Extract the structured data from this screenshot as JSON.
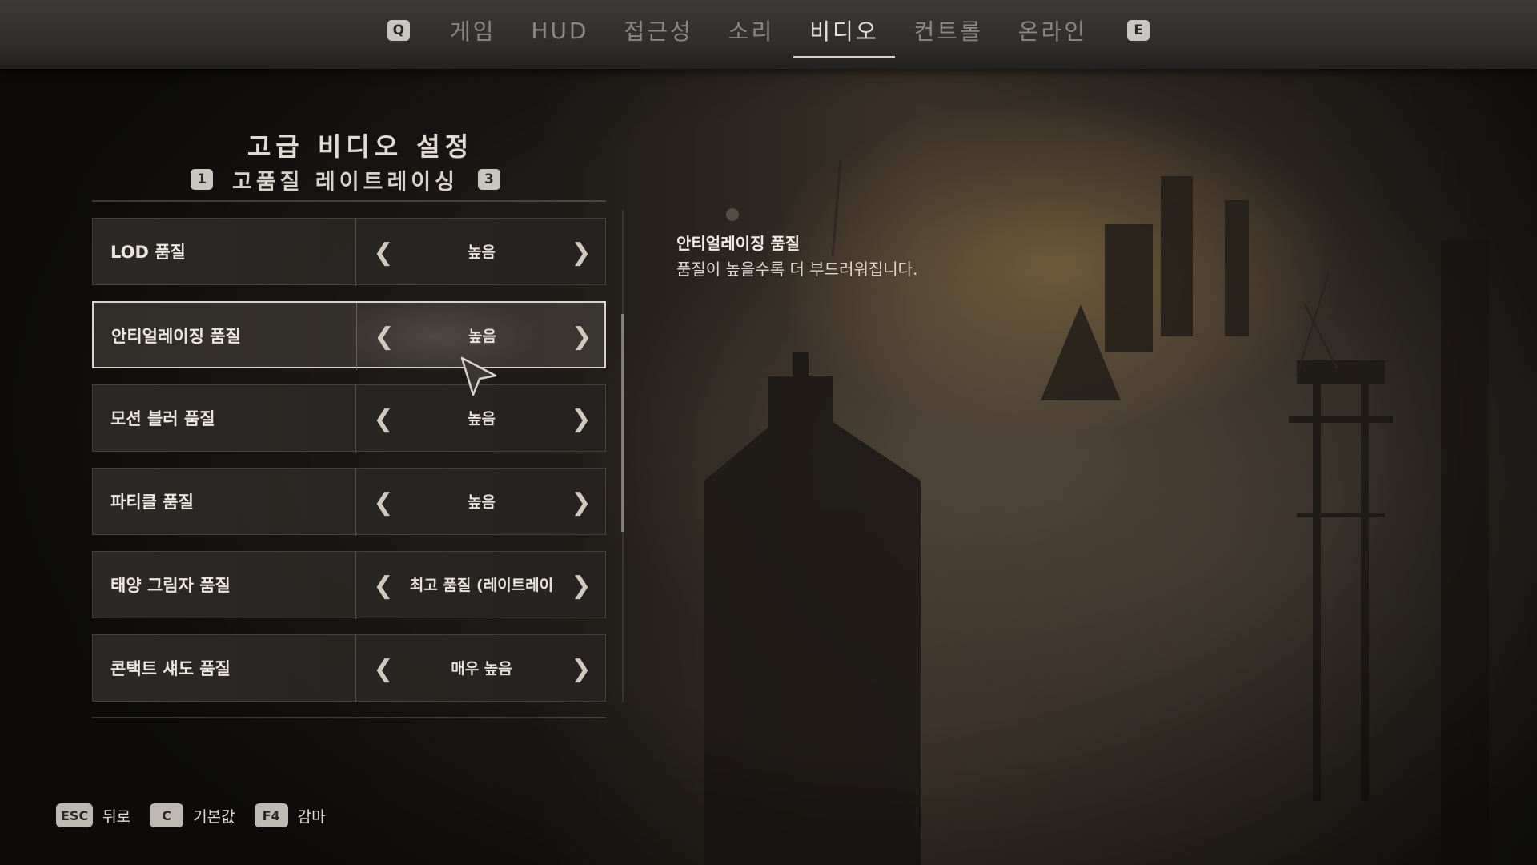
{
  "nav": {
    "left_key": "Q",
    "right_key": "E",
    "tabs": [
      {
        "label": "게임"
      },
      {
        "label": "HUD"
      },
      {
        "label": "접근성"
      },
      {
        "label": "소리"
      },
      {
        "label": "비디오"
      },
      {
        "label": "컨트롤"
      },
      {
        "label": "온라인"
      }
    ],
    "active_tab": "비디오"
  },
  "header": {
    "title": "고급 비디오 설정",
    "subtab_left_key": "1",
    "subtab_label": "고품질 레이트레이싱",
    "subtab_right_key": "3"
  },
  "settings": [
    {
      "label": "LOD 품질",
      "value": "높음"
    },
    {
      "label": "안티얼레이징 품질",
      "value": "높음"
    },
    {
      "label": "모션 블러 품질",
      "value": "높음"
    },
    {
      "label": "파티클 품질",
      "value": "높음"
    },
    {
      "label": "태양 그림자 품질",
      "value": "최고 품질 (레이트레이"
    },
    {
      "label": "콘택트 섀도 품질",
      "value": "매우 높음"
    }
  ],
  "selected_setting": "안티얼레이징 품질",
  "description": {
    "title": "안티얼레이징 품질",
    "text": "품질이 높을수록 더 부드러워집니다."
  },
  "footer": {
    "hints": [
      {
        "key": "ESC",
        "label": "뒤로"
      },
      {
        "key": "C",
        "label": "기본값"
      },
      {
        "key": "F4",
        "label": "감마"
      }
    ]
  },
  "icons": {
    "arrow_left": "chevron-left-icon",
    "arrow_right": "chevron-right-icon",
    "cursor": "mouse-pointer-icon"
  }
}
